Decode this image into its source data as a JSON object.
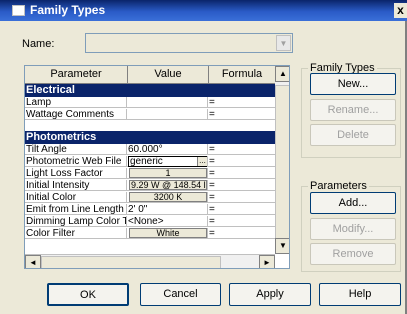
{
  "window": {
    "title": "Family Types",
    "close_glyph": "x"
  },
  "name_field": {
    "label": "Name:",
    "value": "",
    "arrow": "▼"
  },
  "table": {
    "columns": [
      "Parameter",
      "Value",
      "Formula"
    ],
    "groups": [
      {
        "title": "Electrical",
        "rows": [
          {
            "param": "Lamp",
            "value": "",
            "formula": "="
          },
          {
            "param": "Wattage Comments",
            "value": "",
            "formula": "="
          }
        ]
      },
      {
        "title": "Photometrics",
        "rows": [
          {
            "param": "Tilt Angle",
            "value": "60.000°",
            "formula": "="
          },
          {
            "param": "Photometric Web File",
            "value": "generic",
            "formula": "="
          },
          {
            "param": "Light Loss Factor",
            "value": "1",
            "formula": "="
          },
          {
            "param": "Initial Intensity",
            "value": "9.29 W @ 148.54 l",
            "formula": "="
          },
          {
            "param": "Initial Color",
            "value": "3200 K",
            "formula": "="
          },
          {
            "param": "Emit from Line Length",
            "value": "2'  0\"",
            "formula": "="
          },
          {
            "param": "Dimming Lamp Color Te",
            "value": "<None>",
            "formula": "="
          },
          {
            "param": "Color Filter",
            "value": "White",
            "formula": "="
          }
        ]
      }
    ],
    "ellipsis": "...",
    "scroll_up": "▲",
    "scroll_down": "▼",
    "scroll_left": "◄",
    "scroll_right": "►"
  },
  "family_types": {
    "legend": "Family Types",
    "new": "New...",
    "rename": "Rename...",
    "delete": "Delete"
  },
  "parameters": {
    "legend": "Parameters",
    "add": "Add...",
    "modify": "Modify...",
    "remove": "Remove"
  },
  "footer": {
    "ok": "OK",
    "cancel": "Cancel",
    "apply": "Apply",
    "help": "Help"
  },
  "colors": {
    "titlebar": "#0a246a",
    "group_header": "#0a246a",
    "dialog_bg": "#ece9d8"
  }
}
